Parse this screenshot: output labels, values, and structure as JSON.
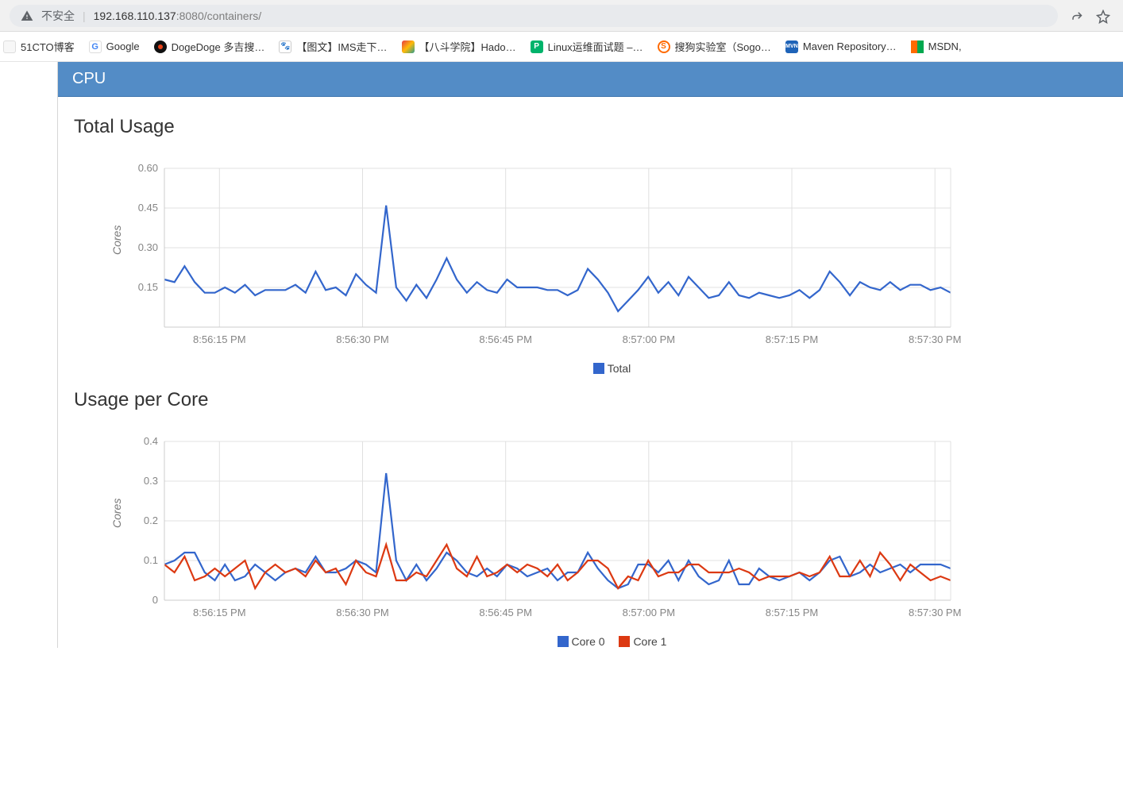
{
  "browser": {
    "security_label": "不安全",
    "url_host": "192.168.110.137",
    "url_port": ":8080",
    "url_path": "/containers/"
  },
  "bookmarks": [
    {
      "label": "51CTO博客",
      "color": "#eee"
    },
    {
      "label": "Google",
      "color": "#fff"
    },
    {
      "label": "DogeDoge 多吉搜…",
      "color": "#111"
    },
    {
      "label": "【图文】IMS走下…",
      "color": "#3b7dd8"
    },
    {
      "label": "【八斗学院】Hado…",
      "color": "#2b2b2b"
    },
    {
      "label": "Linux运维面试题 –…",
      "color": "#00b36b"
    },
    {
      "label": "搜狗实验室（Sogo…",
      "color": "#ff6a00"
    },
    {
      "label": "Maven Repository…",
      "color": "#1e63b8"
    },
    {
      "label": "MSDN,",
      "color": "#ff6a00"
    }
  ],
  "panel_title": "CPU",
  "section1_title": "Total Usage",
  "section2_title": "Usage per Core",
  "ylabel": "Cores",
  "legend_total": "Total",
  "legend_core0": "Core 0",
  "legend_core1": "Core 1",
  "colors": {
    "total": "#3366cc",
    "core0": "#3366cc",
    "core1": "#dc3912"
  },
  "chart_data": [
    {
      "type": "line",
      "title": "Total Usage",
      "xlabel": "",
      "ylabel": "Cores",
      "ylim": [
        0.0,
        0.6
      ],
      "yticks": [
        0.15,
        0.3,
        0.45,
        0.6
      ],
      "x_categories": [
        "8:56:15 PM",
        "8:56:30 PM",
        "8:56:45 PM",
        "8:57:00 PM",
        "8:57:15 PM",
        "8:57:30 PM"
      ],
      "series": [
        {
          "name": "Total",
          "values": [
            0.18,
            0.17,
            0.23,
            0.17,
            0.13,
            0.13,
            0.15,
            0.13,
            0.16,
            0.12,
            0.14,
            0.14,
            0.14,
            0.16,
            0.13,
            0.21,
            0.14,
            0.15,
            0.12,
            0.2,
            0.16,
            0.13,
            0.46,
            0.15,
            0.1,
            0.16,
            0.11,
            0.18,
            0.26,
            0.18,
            0.13,
            0.17,
            0.14,
            0.13,
            0.18,
            0.15,
            0.15,
            0.15,
            0.14,
            0.14,
            0.12,
            0.14,
            0.22,
            0.18,
            0.13,
            0.06,
            0.1,
            0.14,
            0.19,
            0.13,
            0.17,
            0.12,
            0.19,
            0.15,
            0.11,
            0.12,
            0.17,
            0.12,
            0.11,
            0.13,
            0.12,
            0.11,
            0.12,
            0.14,
            0.11,
            0.14,
            0.21,
            0.17,
            0.12,
            0.17,
            0.15,
            0.14,
            0.17,
            0.14,
            0.16,
            0.16,
            0.14,
            0.15,
            0.13
          ]
        }
      ]
    },
    {
      "type": "line",
      "title": "Usage per Core",
      "xlabel": "",
      "ylabel": "Cores",
      "ylim": [
        0.0,
        0.4
      ],
      "yticks": [
        0.0,
        0.1,
        0.2,
        0.3,
        0.4
      ],
      "x_categories": [
        "8:56:15 PM",
        "8:56:30 PM",
        "8:56:45 PM",
        "8:57:00 PM",
        "8:57:15 PM",
        "8:57:30 PM"
      ],
      "series": [
        {
          "name": "Core 0",
          "values": [
            0.09,
            0.1,
            0.12,
            0.12,
            0.07,
            0.05,
            0.09,
            0.05,
            0.06,
            0.09,
            0.07,
            0.05,
            0.07,
            0.08,
            0.07,
            0.11,
            0.07,
            0.07,
            0.08,
            0.1,
            0.09,
            0.07,
            0.32,
            0.1,
            0.05,
            0.09,
            0.05,
            0.08,
            0.12,
            0.1,
            0.07,
            0.06,
            0.08,
            0.06,
            0.09,
            0.08,
            0.06,
            0.07,
            0.08,
            0.05,
            0.07,
            0.07,
            0.12,
            0.08,
            0.05,
            0.03,
            0.04,
            0.09,
            0.09,
            0.07,
            0.1,
            0.05,
            0.1,
            0.06,
            0.04,
            0.05,
            0.1,
            0.04,
            0.04,
            0.08,
            0.06,
            0.05,
            0.06,
            0.07,
            0.05,
            0.07,
            0.1,
            0.11,
            0.06,
            0.07,
            0.09,
            0.07,
            0.08,
            0.09,
            0.07,
            0.09,
            0.09,
            0.09,
            0.08
          ]
        },
        {
          "name": "Core 1",
          "values": [
            0.09,
            0.07,
            0.11,
            0.05,
            0.06,
            0.08,
            0.06,
            0.08,
            0.1,
            0.03,
            0.07,
            0.09,
            0.07,
            0.08,
            0.06,
            0.1,
            0.07,
            0.08,
            0.04,
            0.1,
            0.07,
            0.06,
            0.14,
            0.05,
            0.05,
            0.07,
            0.06,
            0.1,
            0.14,
            0.08,
            0.06,
            0.11,
            0.06,
            0.07,
            0.09,
            0.07,
            0.09,
            0.08,
            0.06,
            0.09,
            0.05,
            0.07,
            0.1,
            0.1,
            0.08,
            0.03,
            0.06,
            0.05,
            0.1,
            0.06,
            0.07,
            0.07,
            0.09,
            0.09,
            0.07,
            0.07,
            0.07,
            0.08,
            0.07,
            0.05,
            0.06,
            0.06,
            0.06,
            0.07,
            0.06,
            0.07,
            0.11,
            0.06,
            0.06,
            0.1,
            0.06,
            0.12,
            0.09,
            0.05,
            0.09,
            0.07,
            0.05,
            0.06,
            0.05
          ]
        }
      ]
    }
  ]
}
